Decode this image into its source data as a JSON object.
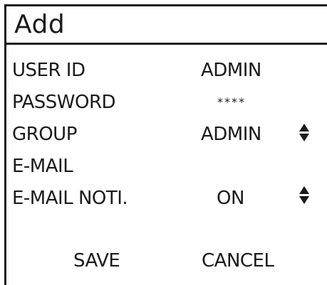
{
  "dialog": {
    "title": "Add",
    "rows": [
      {
        "label": "USER ID",
        "value": "ADMIN"
      },
      {
        "label": "PASSWORD",
        "value": "****"
      },
      {
        "label": "GROUP",
        "value": "ADMIN",
        "spinner_icon": "up-down-arrows-icon"
      },
      {
        "label": "E-MAIL",
        "value": ""
      },
      {
        "label": "E-MAIL NOTI.",
        "value": "ON",
        "spinner_icon": "up-down-arrows-icon"
      }
    ],
    "buttons": {
      "save": "SAVE",
      "cancel": "CANCEL"
    }
  }
}
